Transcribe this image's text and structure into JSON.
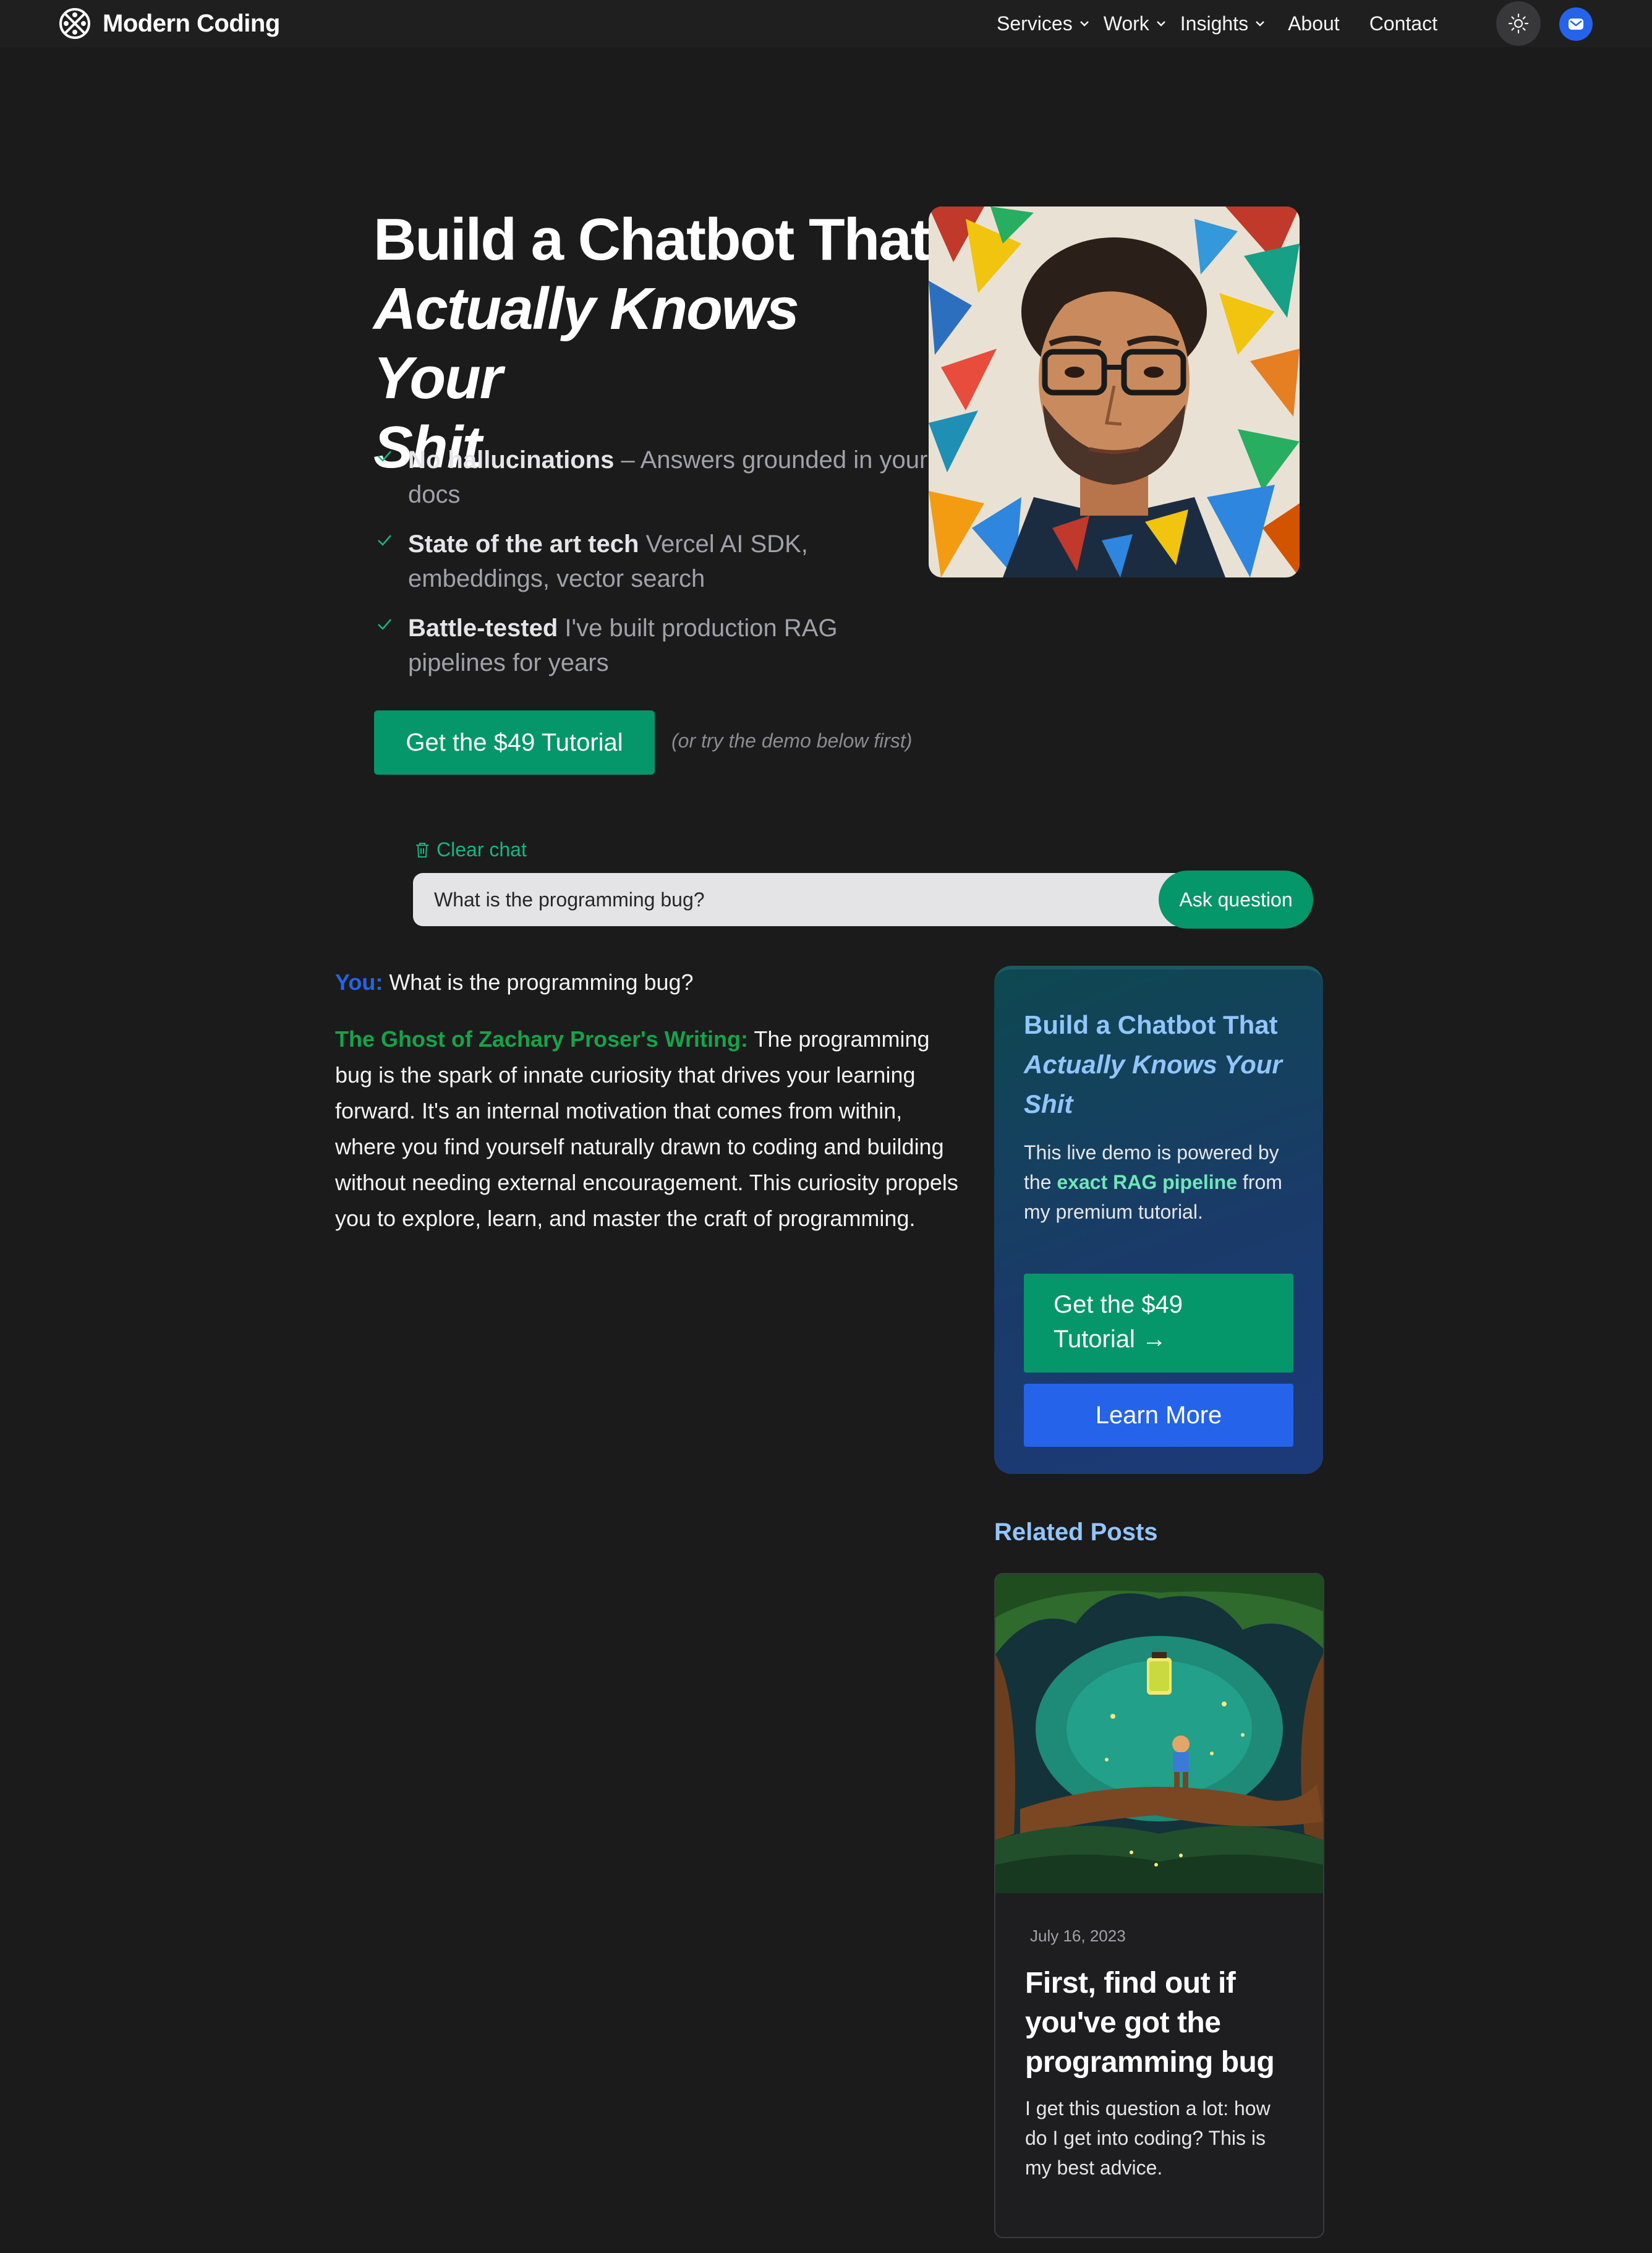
{
  "nav": {
    "brand": "Modern Coding",
    "items": [
      {
        "label": "Services",
        "dropdown": true
      },
      {
        "label": "Work",
        "dropdown": true
      },
      {
        "label": "Insights",
        "dropdown": true
      },
      {
        "label": "About",
        "dropdown": false
      },
      {
        "label": "Contact",
        "dropdown": false
      }
    ],
    "icons": [
      "theme-toggle-sun-icon",
      "mail-icon"
    ]
  },
  "hero": {
    "title_line1": "Build a Chatbot That",
    "title_line2": "Actually Knows Your",
    "title_line3": "Shit",
    "features": [
      {
        "bold": "No hallucinations",
        "text": " – Answers grounded in your docs"
      },
      {
        "bold": "State of the art tech",
        "text": " Vercel AI SDK, embeddings, vector search"
      },
      {
        "bold": "Battle-tested",
        "text": " I've built production RAG pipelines for years"
      }
    ],
    "cta_label": "Get the $49 Tutorial",
    "cta_note": "(or try the demo below first)"
  },
  "chat": {
    "clear_label": "Clear chat",
    "input_value": "What is the programming bug?",
    "ask_label": "Ask question",
    "user_label": "You:",
    "user_message": "What is the programming bug?",
    "bot_label": "The Ghost of Zachary Proser's Writing:",
    "bot_message": "The programming bug is the spark of innate curiosity that drives your learning forward. It's an internal motivation that comes from within, where you find yourself naturally drawn to coding and building without needing external encouragement. This curiosity propels you to explore, learn, and master the craft of programming."
  },
  "promo": {
    "title_line1": "Build a Chatbot That",
    "title_line2": "Actually Knows Your",
    "title_line3": "Shit",
    "text_before": "This live demo is powered by the ",
    "text_highlight": "exact RAG pipeline",
    "text_after": " from my premium tutorial.",
    "buy_label": "Get the $49 Tutorial →",
    "learn_label": "Learn More"
  },
  "related": {
    "heading": "Related Posts",
    "posts": [
      {
        "date": "July 16, 2023",
        "title": "First, find out if you've got the programming bug",
        "excerpt": "I get this question a lot: how do I get into coding? This is my best advice."
      }
    ]
  },
  "colors": {
    "background": "#1b1b1b",
    "accent_green": "#059669",
    "accent_blue": "#2563eb",
    "highlight_green": "#6ee7b7",
    "heading_blue": "#93c5fd"
  }
}
